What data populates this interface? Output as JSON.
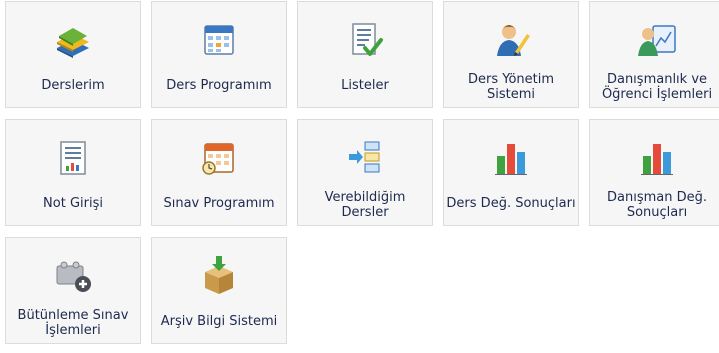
{
  "tiles": [
    {
      "label": "Derslerim",
      "icon": "books-icon"
    },
    {
      "label": "Ders Programım",
      "icon": "calendar-icon"
    },
    {
      "label": "Listeler",
      "icon": "list-check-icon"
    },
    {
      "label": "Ders Yönetim\nSistemi",
      "icon": "teacher-icon"
    },
    {
      "label": "Danışmanlık ve\nÖğrenci İşlemleri",
      "icon": "advisor-icon"
    },
    {
      "label": "Not Girişi",
      "icon": "grade-sheet-icon"
    },
    {
      "label": "Sınav Programım",
      "icon": "exam-calendar-icon"
    },
    {
      "label": "Verebildiğim\nDersler",
      "icon": "flow-icon"
    },
    {
      "label": "Ders Değ. Sonuçları",
      "icon": "bar-chart-icon"
    },
    {
      "label": "Danışman Değ.\nSonuçları",
      "icon": "bar-chart-icon"
    },
    {
      "label": "Bütünleme Sınav\nİşlemleri",
      "icon": "add-blocks-icon"
    },
    {
      "label": "Arşiv Bilgi Sistemi",
      "icon": "archive-box-icon"
    }
  ]
}
